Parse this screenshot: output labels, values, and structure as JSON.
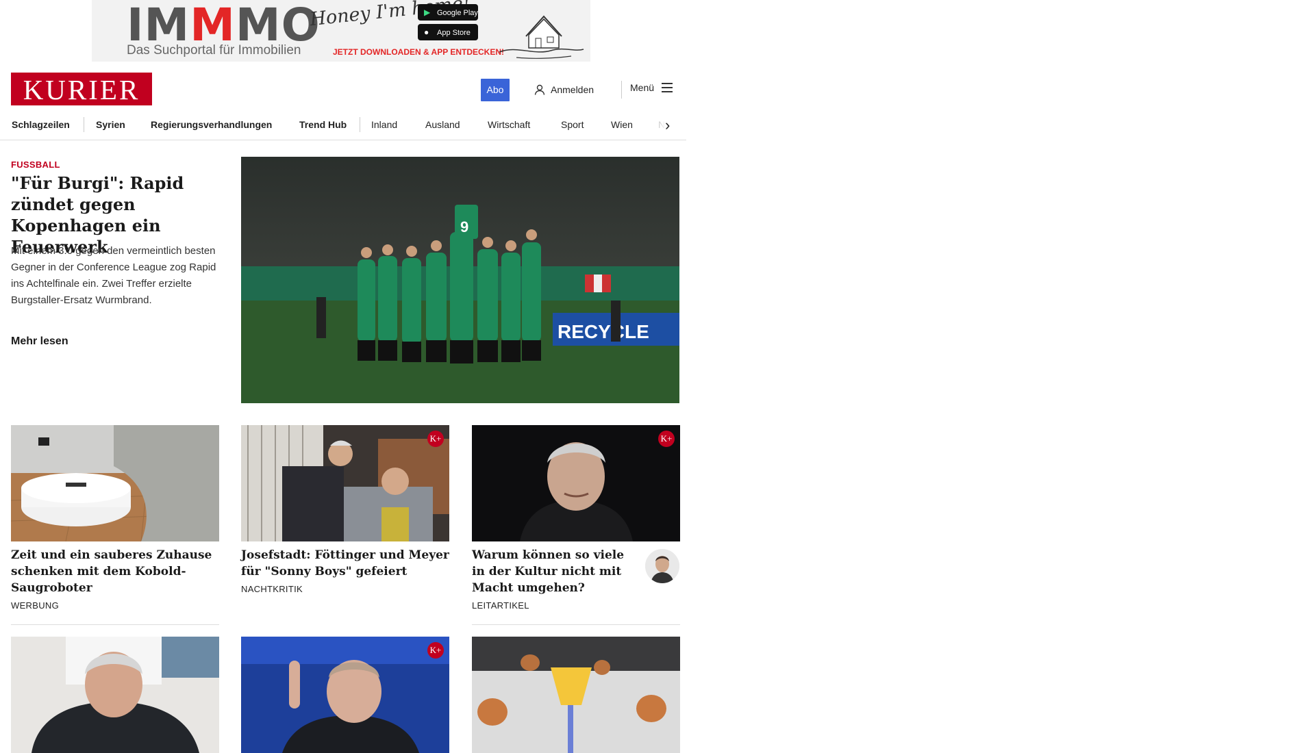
{
  "ad": {
    "logo_prefix": "IM",
    "logo_m": "M",
    "logo_suffix": "MO",
    "tagline": "Das Suchportal für Immobilien",
    "script": "Honey I'm home!",
    "google_play": "Google Play",
    "app_store": "App Store",
    "cta": "JETZT DOWNLOADEN & APP ENTDECKEN!"
  },
  "header": {
    "logo": "KURIER",
    "abo": "Abo",
    "login": "Anmelden",
    "menu": "Menü"
  },
  "nav": {
    "items": [
      "Schlagzeilen",
      "Syrien",
      "Regierungsverhandlungen",
      "Trend Hub",
      "Inland",
      "Ausland",
      "Wirtschaft",
      "Sport",
      "Wien",
      "NÖ"
    ]
  },
  "lead": {
    "kicker": "FUSSBALL",
    "title": "\"Für Burgi\": Rapid zündet gegen Kopenhagen ein Feuerwerk",
    "teaser": "Mit einem 3:0 gegen den vermeintlich besten Gegner in der Conference League zog Rapid ins Achtelfinale ein. Zwei Treffer erzielte Burgstaller-Ersatz Wurmbrand.",
    "more": "Mehr lesen",
    "image_text": "RECYCLE"
  },
  "cards": [
    {
      "title": "Zeit und ein sauberes Zuhause schenken mit dem Kobold-Saugroboter",
      "label": "WERBUNG"
    },
    {
      "title": "Josefstadt: Föttinger und Meyer für \"Sonny Boys\" gefeiert",
      "label": "NACHTKRITIK",
      "badge": "K+"
    },
    {
      "title": "Warum können so viele in der Kultur nicht mit Macht umgehen?",
      "label": "LEITARTIKEL",
      "badge": "K+"
    }
  ],
  "cards_row2": [
    {
      "badge": ""
    },
    {
      "badge": "K+"
    },
    {
      "badge": ""
    }
  ],
  "colors": {
    "brand_red": "#c1001f",
    "abo_blue": "#3a64d8"
  }
}
